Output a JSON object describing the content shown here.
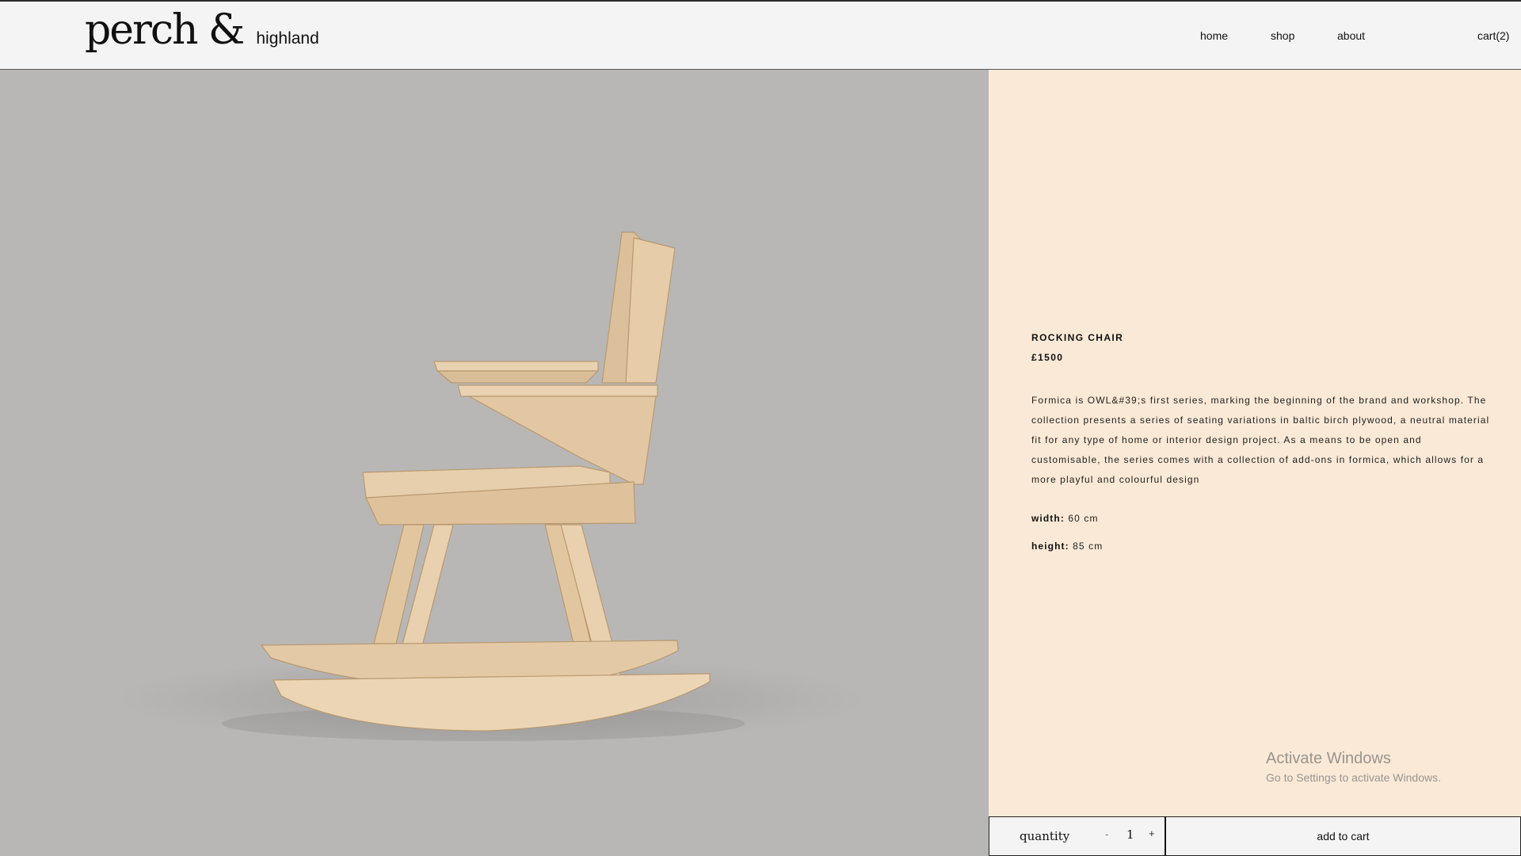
{
  "header": {
    "logo_main": "perch &",
    "logo_sub": "highland",
    "nav": {
      "home": "home",
      "shop": "shop",
      "about": "about",
      "cart": "cart(2)"
    }
  },
  "product": {
    "name": "ROCKING CHAIR",
    "price": "£1500",
    "description": "Formica is OWL&#39;s first series, marking the beginning of the brand and workshop. The collection presents a series of seating variations in baltic birch plywood, a neutral material fit for any type of home or interior design project. As a means to be open and customisable, the series comes with a collection of add-ons in formica, which allows for a more playful and colourful design",
    "width_label": "width:",
    "width_value": "60 cm",
    "height_label": "height:",
    "height_value": "85 cm",
    "image_subject": "wooden rocking chair, side view"
  },
  "cart_controls": {
    "quantity_label": "quantity",
    "minus": "-",
    "quantity_value": "1",
    "plus": "+",
    "add_to_cart": "add to cart"
  },
  "os_overlay": {
    "title": "Activate Windows",
    "subtitle": "Go to Settings to activate Windows."
  },
  "colors": {
    "header_bg": "#f4f4f4",
    "image_bg": "#b8b7b6",
    "info_bg": "#fae9d6",
    "wood": "#e4c9a6"
  }
}
